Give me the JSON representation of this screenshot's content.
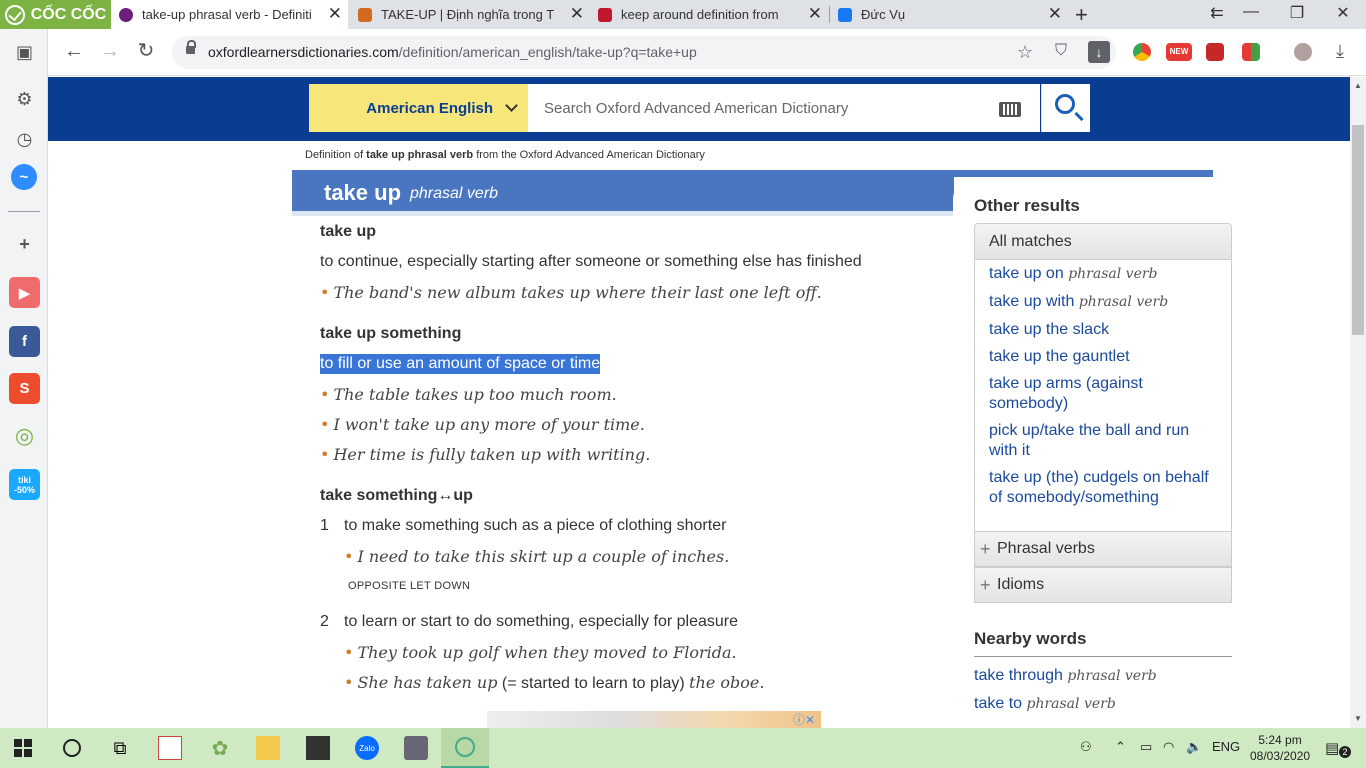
{
  "browser": {
    "brand": "CỐC CỐC",
    "tabs": [
      {
        "title": "take-up phrasal verb - Definiti",
        "active": true,
        "icon": "oxford-icon",
        "color": "#6b1e7a"
      },
      {
        "title": "TAKE-UP | Định nghĩa trong T",
        "active": false,
        "icon": "cambridge-icon",
        "color": "#d2691e"
      },
      {
        "title": "keep around definition from",
        "active": false,
        "icon": "macmillan-icon",
        "color": "#c0182f"
      },
      {
        "title": "Đức Vụ",
        "active": false,
        "icon": "facebook-icon",
        "color": "#1877f2"
      }
    ],
    "url_host": "oxfordlearnersdictionaries.com",
    "url_path": "/definition/american_english/take-up?q=take+up"
  },
  "site": {
    "language_selector": "American English",
    "search_placeholder": "Search Oxford Advanced American Dictionary",
    "breadcrumb": {
      "pre": "Definition of ",
      "term": "take up phrasal verb",
      "post": " from the Oxford Advanced American Dictionary"
    }
  },
  "entry": {
    "headword": "take up",
    "pos": "phrasal verb",
    "senses": [
      {
        "phrase": "take up",
        "definition": "to continue, especially starting after someone or something else has finished",
        "examples": [
          "The band's new album takes up where their last one left off."
        ]
      },
      {
        "phrase": "take up something",
        "definition": "to fill or use an amount of space or time",
        "examples": [
          "The table takes up too much room.",
          "I won't take up any more of your time.",
          "Her time is fully taken up with writing."
        ]
      },
      {
        "phrase": "take something↔up"
      }
    ],
    "numbered": [
      {
        "n": "1",
        "definition": "to make something such as a piece of clothing shorter",
        "examples": [
          "I need to take this skirt up a couple of inches."
        ],
        "opposite_label": "OPPOSITE",
        "opposite": "LET DOWN"
      },
      {
        "n": "2",
        "definition": "to learn or start to do something, especially for pleasure",
        "examples": [
          "They took up golf when they moved to Florida."
        ],
        "ex2_a": "She has taken up",
        "ex2_b": " (= started to learn to play) ",
        "ex2_c": "the oboe."
      }
    ]
  },
  "side": {
    "other_results": "Other results",
    "all_matches": "All matches",
    "results": [
      {
        "text": "take up on",
        "pos": "phrasal verb"
      },
      {
        "text": "take up with",
        "pos": "phrasal verb"
      },
      {
        "text": "take up the slack",
        "pos": ""
      },
      {
        "text": "take up the gauntlet",
        "pos": ""
      },
      {
        "text": "take up arms (against somebody)",
        "pos": ""
      },
      {
        "text": "pick up/take the ball and run with it",
        "pos": ""
      },
      {
        "text": "take up (the) cudgels on behalf of somebody/something",
        "pos": ""
      }
    ],
    "phrasal_verbs": "Phrasal verbs",
    "idioms": "Idioms",
    "nearby_words": "Nearby words",
    "nearby": [
      {
        "text": "take through",
        "pos": "phrasal verb"
      },
      {
        "text": "take to",
        "pos": "phrasal verb"
      }
    ]
  },
  "taskbar": {
    "lang": "ENG",
    "time": "5:24 pm",
    "date": "08/03/2020",
    "notifications": "2"
  }
}
